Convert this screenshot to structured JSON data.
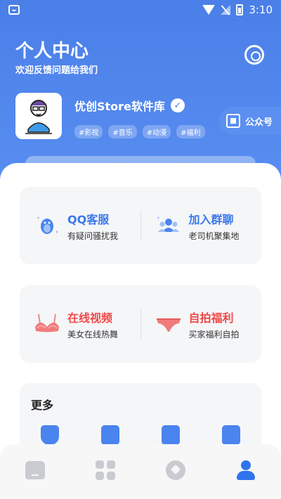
{
  "statusbar": {
    "time": "3:10"
  },
  "header": {
    "title": "个人中心",
    "subtitle": "欢迎反馈问题给我们"
  },
  "profile": {
    "name": "优创Store软件库",
    "verified_mark": "✓",
    "tags": [
      "#影视",
      "#音乐",
      "#动漫",
      "#福利"
    ],
    "official_label": "公众号"
  },
  "cards": {
    "qq": {
      "title": "QQ客服",
      "desc": "有疑问骚扰我"
    },
    "group": {
      "title": "加入群聊",
      "desc": "老司机聚集地"
    },
    "video": {
      "title": "在线视频",
      "desc": "美女在线热舞"
    },
    "selfie": {
      "title": "自拍福利",
      "desc": "买家福利自拍"
    }
  },
  "more": {
    "title": "更多",
    "icons": [
      "shield-icon",
      "download-file-icon",
      "edit-icon",
      "contact-book-icon"
    ]
  },
  "nav": {
    "items": [
      "home-icon",
      "grid-icon",
      "compass-icon",
      "user-icon"
    ],
    "active": "user-icon"
  },
  "colors": {
    "brand": "#4a7fe8",
    "accent_blue": "#3b78ea",
    "accent_red": "#ef4a4a",
    "nav_active": "#2f74ec"
  }
}
